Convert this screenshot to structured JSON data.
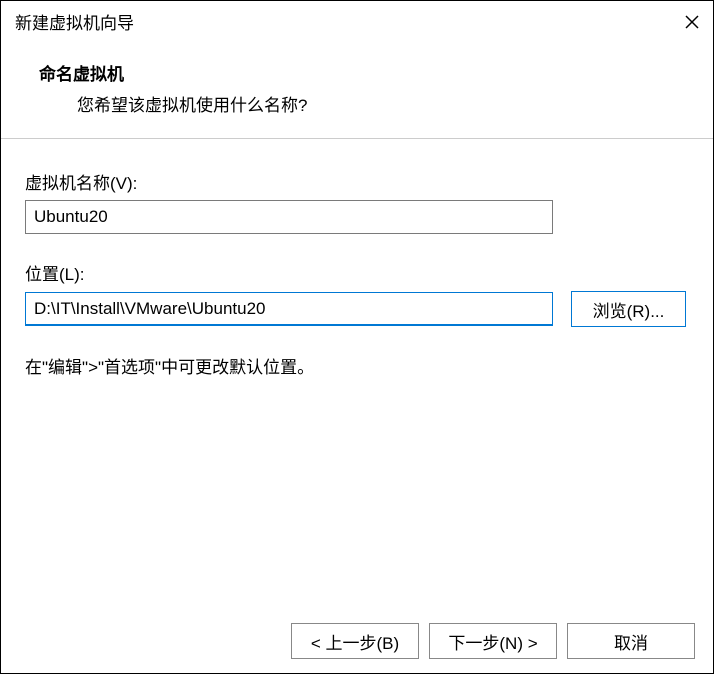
{
  "titlebar": {
    "title": "新建虚拟机向导"
  },
  "header": {
    "title": "命名虚拟机",
    "subtitle": "您希望该虚拟机使用什么名称?"
  },
  "fields": {
    "name": {
      "label": "虚拟机名称(V):",
      "value": "Ubuntu20"
    },
    "location": {
      "label": "位置(L):",
      "value": "D:\\IT\\Install\\VMware\\Ubuntu20",
      "browse_label": "浏览(R)..."
    }
  },
  "hint": "在\"编辑\">\"首选项\"中可更改默认位置。",
  "footer": {
    "back": "< 上一步(B)",
    "next": "下一步(N) >",
    "cancel": "取消"
  }
}
